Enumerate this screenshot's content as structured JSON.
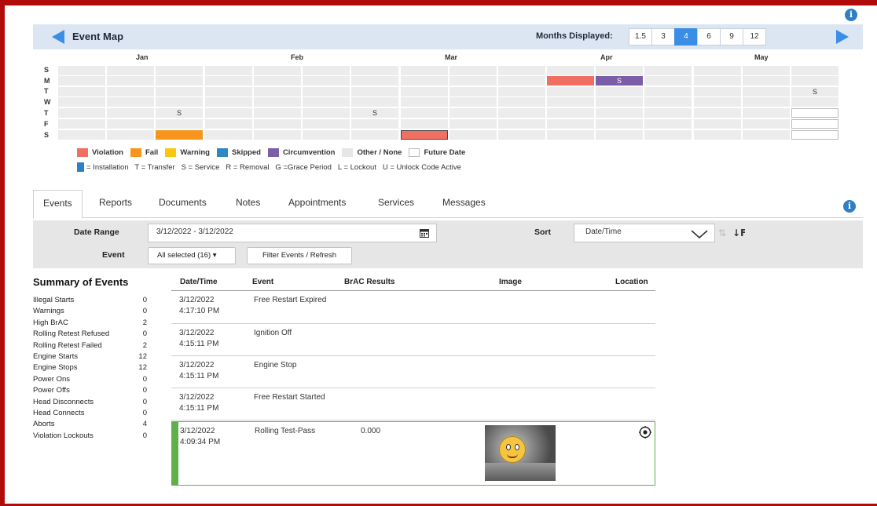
{
  "event_map": {
    "title": "Event Map",
    "months_displayed_label": "Months Displayed:",
    "month_options": [
      "1.5",
      "3",
      "4",
      "6",
      "9",
      "12"
    ],
    "selected_months": "4",
    "months": [
      "Jan",
      "Feb",
      "Mar",
      "Apr",
      "May"
    ],
    "days": [
      "S",
      "M",
      "T",
      "W",
      "T",
      "F",
      "S"
    ]
  },
  "legend": {
    "items": [
      {
        "label": "Violation",
        "color": "#ef6f63"
      },
      {
        "label": "Fail",
        "color": "#f7941d"
      },
      {
        "label": "Warning",
        "color": "#f9c80e"
      },
      {
        "label": "Skipped",
        "color": "#2f86c5"
      },
      {
        "label": "Circumvention",
        "color": "#7b5ea7"
      },
      {
        "label": "Other / None",
        "color": "#e6e6e6"
      },
      {
        "label": "Future Date",
        "color": "#ffffff"
      }
    ],
    "codes": "= Installation   T = Transfer   S = Service   R = Removal   G =Grace Period   L = Lockout   U = Unlock Code Active"
  },
  "tabs": [
    "Events",
    "Reports",
    "Documents",
    "Notes",
    "Appointments",
    "Services",
    "Messages"
  ],
  "filter": {
    "date_range_label": "Date Range",
    "date_range_value": "3/12/2022 - 3/12/2022",
    "sort_label": "Sort",
    "sort_value": "Date/Time",
    "event_label": "Event",
    "event_value": "All selected (16)",
    "filter_button": "Filter Events / Refresh"
  },
  "summary": {
    "title": "Summary of Events",
    "rows": [
      {
        "label": "Illegal Starts",
        "value": "0"
      },
      {
        "label": "Warnings",
        "value": "0"
      },
      {
        "label": "High BrAC",
        "value": "2"
      },
      {
        "label": "Rolling Retest Refused",
        "value": "0"
      },
      {
        "label": "Rolling Retest Failed",
        "value": "2"
      },
      {
        "label": "Engine Starts",
        "value": "12"
      },
      {
        "label": "Engine Stops",
        "value": "12"
      },
      {
        "label": "Power Ons",
        "value": "0"
      },
      {
        "label": "Power Offs",
        "value": "0"
      },
      {
        "label": "Head Disconnects",
        "value": "0"
      },
      {
        "label": "Head Connects",
        "value": "0"
      },
      {
        "label": "Aborts",
        "value": "4"
      },
      {
        "label": "Violation Lockouts",
        "value": "0"
      }
    ]
  },
  "events_table": {
    "headers": [
      "Date/Time",
      "Event",
      "BrAC Results",
      "Image",
      "Location"
    ],
    "rows": [
      {
        "date": "3/12/2022",
        "time": "4:17:10 PM",
        "event": "Free Restart Expired",
        "brac": ""
      },
      {
        "date": "3/12/2022",
        "time": "4:15:11 PM",
        "event": "Ignition Off",
        "brac": ""
      },
      {
        "date": "3/12/2022",
        "time": "4:15:11 PM",
        "event": "Engine Stop",
        "brac": ""
      },
      {
        "date": "3/12/2022",
        "time": "4:15:11 PM",
        "event": "Free Restart Started",
        "brac": ""
      },
      {
        "date": "3/12/2022",
        "time": "4:09:34 PM",
        "event": "Rolling Test-Pass",
        "brac": "0.000"
      }
    ]
  },
  "calendar_marks": {
    "service_letter": "S"
  }
}
